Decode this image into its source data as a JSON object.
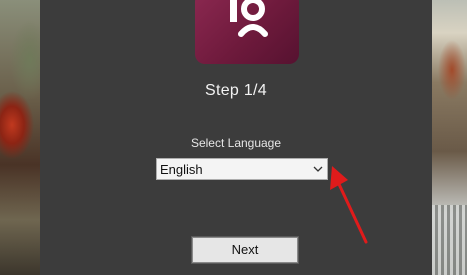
{
  "step": {
    "title": "Step 1/4"
  },
  "language": {
    "label": "Select Language",
    "selected": "English"
  },
  "actions": {
    "next_label": "Next"
  },
  "icons": {
    "app_logo": "app-logo-icon",
    "dropdown": "chevron-down-icon",
    "annotation": "red-arrow-icon"
  },
  "colors": {
    "window_bg": "#3c3c3c",
    "logo_gradient_start": "#8b2850",
    "logo_gradient_end": "#561230",
    "annotation_arrow": "#e01b1b"
  }
}
